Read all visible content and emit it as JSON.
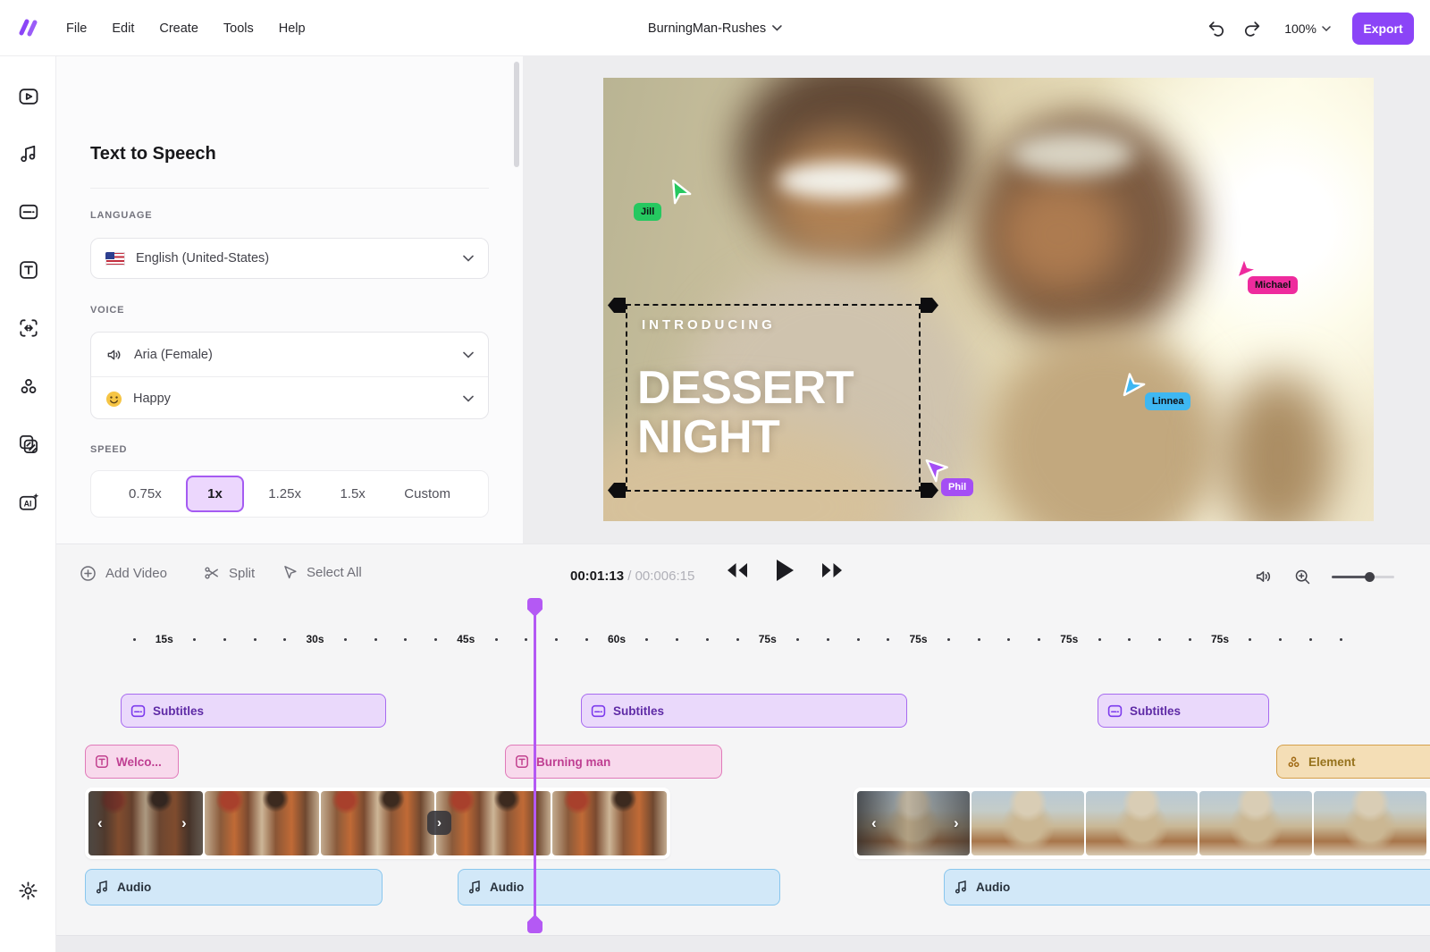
{
  "topbar": {
    "menus": [
      {
        "label": "File"
      },
      {
        "label": "Edit"
      },
      {
        "label": "Create"
      },
      {
        "label": "Tools"
      },
      {
        "label": "Help"
      }
    ],
    "project_name": "BurningMan-Rushes",
    "zoom_level": "100%",
    "export_label": "Export"
  },
  "sidebar": {
    "icons": [
      "video",
      "music",
      "subtitles",
      "text",
      "resize",
      "elements",
      "templates",
      "ai",
      "settings"
    ]
  },
  "tts_panel": {
    "title": "Text to Speech",
    "language": {
      "label": "LANGUAGE",
      "value": "English (United-States)",
      "flag": "us-flag-icon"
    },
    "voice": {
      "label": "VOICE",
      "name": "Aria (Female)",
      "emotion": "Happy"
    },
    "speed": {
      "label": "SPEED",
      "options": [
        {
          "label": "0.75x"
        },
        {
          "label": "1x"
        },
        {
          "label": "1.25x"
        },
        {
          "label": "1.5x"
        },
        {
          "label": "Custom"
        }
      ],
      "selected": "1x"
    }
  },
  "preview": {
    "overlay": {
      "kicker": "INTRODUCING",
      "title_line1": "DESSERT",
      "title_line2": "NIGHT"
    },
    "collaborators": [
      {
        "name": "Jill",
        "color": "#25c860"
      },
      {
        "name": "Michael",
        "color": "#ee2b9d"
      },
      {
        "name": "Linnea",
        "color": "#3eb7f2"
      },
      {
        "name": "Phil",
        "color": "#a44ef4"
      }
    ]
  },
  "timeline": {
    "toolbar": {
      "add_video": "Add Video",
      "split": "Split",
      "select_all": "Select All"
    },
    "time": {
      "current": "00:01:13",
      "separator": " / ",
      "total": "00:006:15"
    },
    "ruler_labels": [
      "15s",
      "30s",
      "45s",
      "60s",
      "75s",
      "75s",
      "75s",
      "75s"
    ],
    "tracks": {
      "subtitles": [
        {
          "label": "Subtitles"
        },
        {
          "label": "Subtitles"
        },
        {
          "label": "Subtitles"
        }
      ],
      "texts": [
        {
          "label": "Welco..."
        },
        {
          "label": "Burning man"
        },
        {
          "label": "Element"
        }
      ],
      "audio": [
        {
          "label": "Audio"
        },
        {
          "label": "Audio"
        },
        {
          "label": "Audio"
        }
      ]
    }
  }
}
